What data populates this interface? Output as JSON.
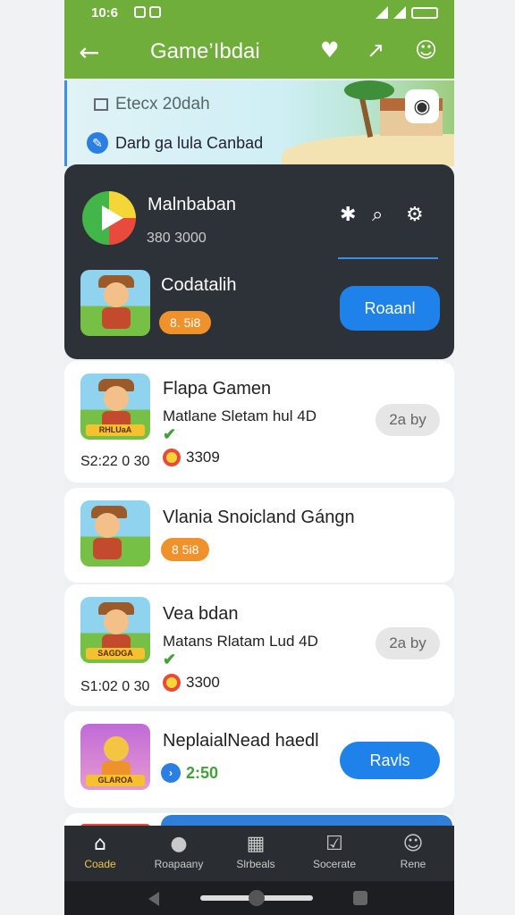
{
  "status_bar": {
    "time": "10:6"
  },
  "app_bar": {
    "title": "Game’Ibdai",
    "back_icon": "arrow-left-icon",
    "icons": [
      "heart-icon",
      "share-icon",
      "profile-icon"
    ]
  },
  "banner": {
    "search_text": "Etecx 20dah",
    "link_text": "Darb ga lula Canbad"
  },
  "featured": {
    "title": "Malnbaban",
    "subtitle": "380 3000",
    "game_name": "Codatalih",
    "badge": "8. 5i8",
    "button": "Roaanl",
    "thumb_label": ""
  },
  "games": [
    {
      "name": "Flapa Gamen",
      "desc": "Matlane Sletam hul 4D",
      "check": "✔",
      "meta": "S2:22 0 30",
      "count": "3309",
      "button": "2a by",
      "thumb_label": "RHLUaA"
    },
    {
      "name": "Vlania Snoicland Gángn",
      "badge": "8 5i8"
    },
    {
      "name": "Vea bdan",
      "desc": "Matans Rlatam Lud 4D",
      "check": "✔",
      "meta": "S1:02 0 30",
      "count": "3300",
      "button": "2a by",
      "thumb_label": "SAGDGA"
    },
    {
      "name": "NeplaialNead haedl",
      "score": "2:50",
      "button": "Ravls",
      "thumb_label": "GLAROA"
    }
  ],
  "bottom_nav": [
    {
      "label": "Coade",
      "icon": "home-icon"
    },
    {
      "label": "Roapaany",
      "icon": "person-icon"
    },
    {
      "label": "Slrbeals",
      "icon": "grid-icon"
    },
    {
      "label": "Socerate",
      "icon": "checkbox-icon"
    },
    {
      "label": "Rene",
      "icon": "account-icon"
    }
  ],
  "colors": {
    "brand_green": "#6fae3a",
    "accent_blue": "#1e82ea",
    "badge_orange": "#f0922b",
    "dark_card": "#2d3238"
  }
}
